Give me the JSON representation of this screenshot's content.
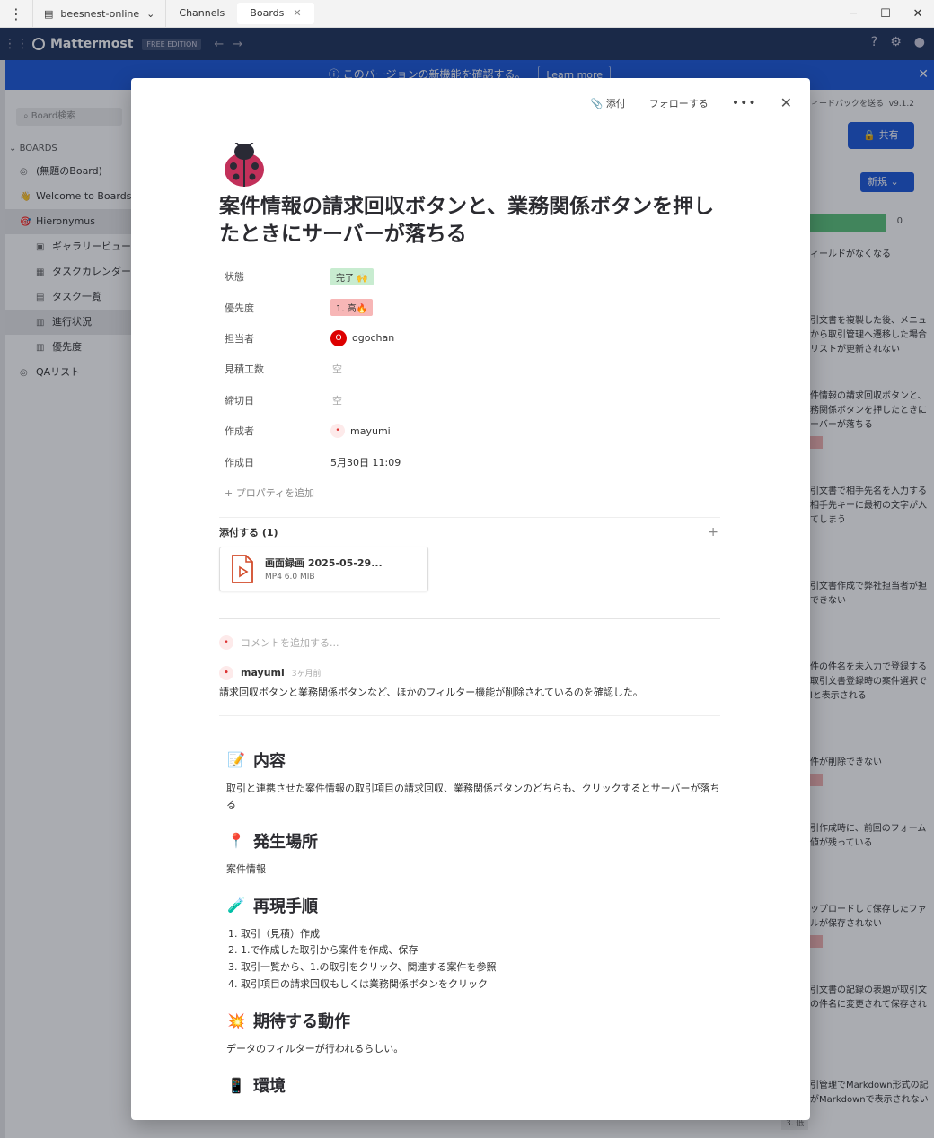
{
  "window": {
    "server": "beesnest-online",
    "tabs": [
      {
        "label": "Channels"
      },
      {
        "label": "Boards"
      }
    ]
  },
  "header": {
    "logo": "Mattermost",
    "edition": "FREE EDITION"
  },
  "banner": {
    "text": "ⓘ このバージョンの新機能を確認する。",
    "learn": "Learn more"
  },
  "sidebar": {
    "search_placeholder": "Board検索",
    "section": "BOARDS",
    "items": [
      {
        "label": "(無題のBoard)"
      },
      {
        "label": "Welcome to Boards!"
      },
      {
        "label": "Hieronymus"
      },
      {
        "label": "ギャラリービュー"
      },
      {
        "label": "タスクカレンダー"
      },
      {
        "label": "タスク一覧"
      },
      {
        "label": "進行状況"
      },
      {
        "label": "優先度"
      },
      {
        "label": "QAリスト"
      }
    ]
  },
  "board": {
    "feedback": "ィードバックを送る",
    "version": "v9.1.2",
    "share": "共有",
    "new": "新規",
    "progress_count": "0",
    "cards": [
      {
        "text": "ィールドがなくなる"
      },
      {
        "text": "引文書を複製した後、メニュ\nから取引管理へ遷移した場合\nリストが更新されない"
      },
      {
        "text": "件情報の請求回収ボタンと、\n務関係ボタンを押したときに\nーバーが落ちる"
      },
      {
        "text": "引文書で相手先名を入力する\n相手先キーに最初の文字が入\nてしまう"
      },
      {
        "text": "引文書作成で弊社担当者が担\nできない"
      },
      {
        "text": "件の件名を未入力で登録する\n取引文書登録時の案件選択で\nlと表示される"
      },
      {
        "text": "件が削除できない"
      },
      {
        "text": "引作成時に、前回のフォーム\n値が残っている"
      },
      {
        "text": "ップロードして保存したファ\nルが保存されない"
      },
      {
        "text": "引文書の記録の表題が取引文\nの件名に変更されて保存され"
      },
      {
        "text": "引管理でMarkdown形式の記\nがMarkdownで表示されない"
      }
    ],
    "low_label": "3. 低"
  },
  "modal": {
    "attach_btn": "添付",
    "follow_btn": "フォローする",
    "title": "案件情報の請求回収ボタンと、業務関係ボタンを押したときにサーバーが落ちる",
    "props": {
      "status": {
        "key": "状態",
        "value": "完了 🙌"
      },
      "priority": {
        "key": "優先度",
        "value": "1. 高🔥"
      },
      "assignee": {
        "key": "担当者",
        "avatar": "O",
        "value": "ogochan"
      },
      "estimate": {
        "key": "見積工数",
        "value": "空"
      },
      "due": {
        "key": "締切日",
        "value": "空"
      },
      "creator": {
        "key": "作成者",
        "value": "mayumi"
      },
      "created": {
        "key": "作成日",
        "value": "5月30日 11:09"
      }
    },
    "add_property": "+ プロパティを追加",
    "attachments": {
      "heading": "添付する (1)",
      "file": {
        "name": "画面録画 2025-05-29...",
        "meta": "MP4 6.0 MIB"
      }
    },
    "comment_placeholder": "コメントを追加する...",
    "comment": {
      "author": "mayumi",
      "time": "3ヶ月前",
      "body": "請求回収ボタンと業務関係ボタンなど、ほかのフィルター機能が削除されているのを確認した。"
    },
    "sections": {
      "content": {
        "emoji": "📝",
        "heading": "内容",
        "text": "取引と連携させた案件情報の取引項目の請求回収、業務関係ボタンのどちらも、クリックするとサーバーが落ちる"
      },
      "location": {
        "emoji": "📍",
        "heading": "発生場所",
        "text": "案件情報"
      },
      "repro": {
        "emoji": "🧪",
        "heading": "再現手順",
        "steps": [
          "取引（見積）作成",
          "1.で作成した取引から案件を作成、保存",
          "取引一覧から、1.の取引をクリック、関連する案件を参照",
          "取引項目の請求回収もしくは業務関係ボタンをクリック"
        ]
      },
      "expected": {
        "emoji": "💥",
        "heading": "期待する動作",
        "text": "データのフィルターが行われるらしい。"
      },
      "env": {
        "emoji": "📱",
        "heading": "環境"
      }
    }
  }
}
